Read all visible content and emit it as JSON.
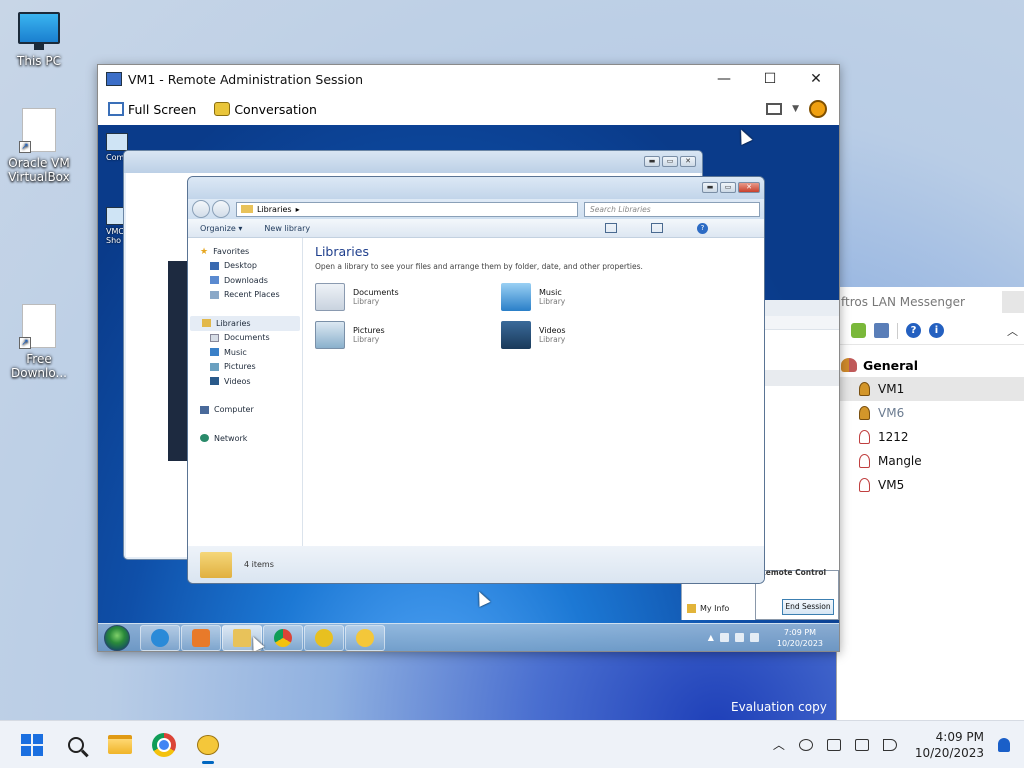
{
  "desktop": {
    "icons": [
      {
        "label": "This PC"
      },
      {
        "label": "Oracle VM VirtualBox"
      },
      {
        "label": "Free Downlo..."
      }
    ],
    "watermark": "Evaluation copy"
  },
  "remote_window": {
    "title": "VM1 - Remote Administration Session",
    "toolbar": {
      "full_screen": "Full Screen",
      "conversation": "Conversation"
    },
    "remote_desktop": {
      "icon_labels": [
        "Com",
        "VMC Sho"
      ],
      "libraries_window": {
        "address": "Libraries",
        "search_placeholder": "Search Libraries",
        "commands": {
          "organize": "Organize ▾",
          "new_library": "New library"
        },
        "nav": {
          "favorites": "Favorites",
          "desktop": "Desktop",
          "downloads": "Downloads",
          "recent_places": "Recent Places",
          "libraries": "Libraries",
          "documents": "Documents",
          "music": "Music",
          "pictures": "Pictures",
          "videos": "Videos",
          "computer": "Computer",
          "network": "Network"
        },
        "heading": "Libraries",
        "subheading": "Open a library to see your files and arrange them by folder, date, and other properties.",
        "items": [
          {
            "name": "Documents",
            "type": "Library"
          },
          {
            "name": "Music",
            "type": "Library"
          },
          {
            "name": "Pictures",
            "type": "Library"
          },
          {
            "name": "Videos",
            "type": "Library"
          }
        ],
        "status": "4 items"
      },
      "messenger_fragment": {
        "title": "nger",
        "my_info": "My Info"
      },
      "remote_control_popup": {
        "title": "Remote Control",
        "end_session": "End Session"
      },
      "taskbar": {
        "time": "7:09 PM",
        "date": "10/20/2023"
      }
    }
  },
  "messenger": {
    "title": "ftros LAN Messenger",
    "group": "General",
    "users": [
      {
        "name": "VM1",
        "status": "online",
        "selected": true
      },
      {
        "name": "VM6",
        "status": "away",
        "selected": false
      },
      {
        "name": "1212",
        "status": "offline",
        "selected": false
      },
      {
        "name": "Mangle",
        "status": "offline",
        "selected": false
      },
      {
        "name": "VM5",
        "status": "offline",
        "selected": false
      }
    ]
  },
  "taskbar": {
    "time": "4:09 PM",
    "date": "10/20/2023"
  },
  "colors": {
    "accent": "#0067c0",
    "remote_bg": "#0f4fa8",
    "library_heading": "#1e3e8c"
  }
}
